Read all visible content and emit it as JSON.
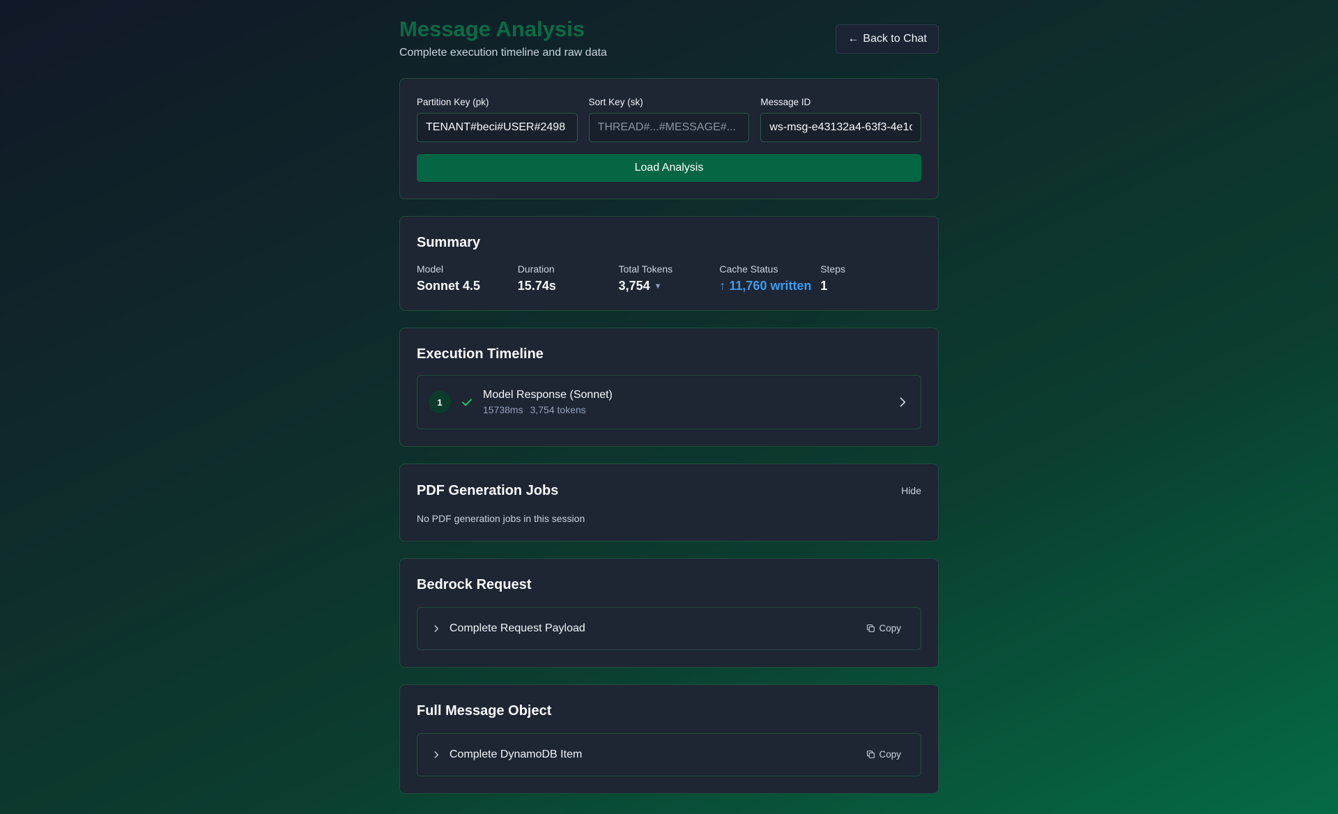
{
  "header": {
    "title": "Message Analysis",
    "subtitle": "Complete execution timeline and raw data",
    "back_button": "Back to Chat",
    "back_arrow": "←"
  },
  "lookup": {
    "pk_label": "Partition Key (pk)",
    "pk_value": "TENANT#beci#USER#2498",
    "sk_label": "Sort Key (sk)",
    "sk_placeholder": "THREAD#...#MESSAGE#...",
    "sk_value": "",
    "msg_label": "Message ID",
    "msg_value": "ws-msg-e43132a4-63f3-4e1c",
    "load_button": "Load Analysis"
  },
  "summary": {
    "heading": "Summary",
    "stats": [
      {
        "label": "Model",
        "value": "Sonnet 4.5"
      },
      {
        "label": "Duration",
        "value": "15.74s"
      },
      {
        "label": "Total Tokens",
        "value": "3,754",
        "suffix": "▼"
      },
      {
        "label": "Cache Status",
        "value": "↑ 11,760 written",
        "color": "#3b9cf0"
      },
      {
        "label": "Steps",
        "value": "1"
      }
    ]
  },
  "timeline": {
    "heading": "Execution Timeline",
    "items": [
      {
        "step": "1",
        "title": "Model Response (Sonnet)",
        "duration": "15738ms",
        "tokens": "3,754 tokens",
        "status_icon": "check-icon"
      }
    ]
  },
  "pdf_jobs": {
    "heading": "PDF Generation Jobs",
    "toggle": "Hide",
    "empty_text": "No PDF generation jobs in this session"
  },
  "bedrock": {
    "heading": "Bedrock Request",
    "row_label": "Complete Request Payload",
    "copy": "Copy"
  },
  "full_message": {
    "heading": "Full Message Object",
    "row_label": "Complete DynamoDB Item",
    "copy": "Copy"
  },
  "colors": {
    "accent": "#0a6b45",
    "button": "#046643",
    "card_bg": "#1e2533",
    "cache_blue": "#3b9cf0",
    "success": "#22c55e"
  }
}
